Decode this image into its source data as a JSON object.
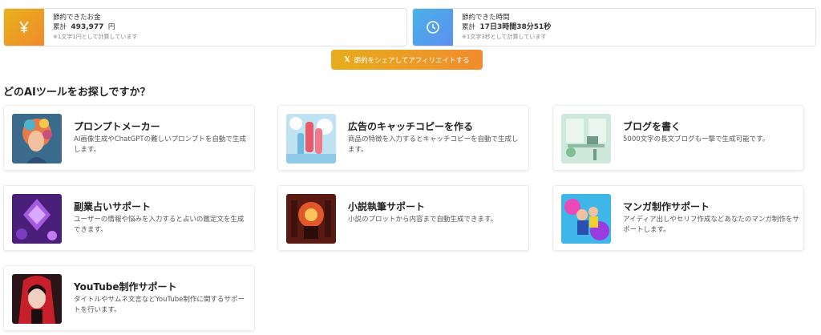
{
  "stats": {
    "money": {
      "title": "節約できたお金",
      "label": "累計",
      "value": "493,977",
      "unit": "円",
      "note": "※1文字1円として計算しています",
      "icon": "yen-icon"
    },
    "time": {
      "title": "節約できた時間",
      "label": "累計",
      "value": "17日3時間38分51秒",
      "note": "※1文字3秒として計算しています",
      "icon": "clock-icon"
    }
  },
  "share_button": {
    "icon": "x-logo-icon",
    "icon_glyph": "𝕏",
    "label": "節約をシェアしてアフィリエイトする"
  },
  "section_title": "どのAIツールをお探しですか？",
  "tools": [
    {
      "name": "プロンプトメーカー",
      "desc": "AI画像生成やChatGPTの難しいプロンプトを自動で生成します。"
    },
    {
      "name": "広告のキャッチコピーを作る",
      "desc": "商品の特徴を入力するとキャッチコピーを自動で生成します。"
    },
    {
      "name": "ブログを書く",
      "desc": "5000文字の長文ブログも一撃で生成可能です。"
    },
    {
      "name": "副業占いサポート",
      "desc": "ユーザーの情報や悩みを入力すると占いの鑑定文を生成できます。"
    },
    {
      "name": "小説執筆サポート",
      "desc": "小説のプロットから内容まで自動生成できます。"
    },
    {
      "name": "マンガ制作サポート",
      "desc": "アイディア出しやセリフ作成などあなたのマンガ制作をサポートします。"
    },
    {
      "name": "YouTube制作サポート",
      "desc": "タイトルやサムネ文言などYouTube制作に関するサポートを行います。"
    }
  ]
}
